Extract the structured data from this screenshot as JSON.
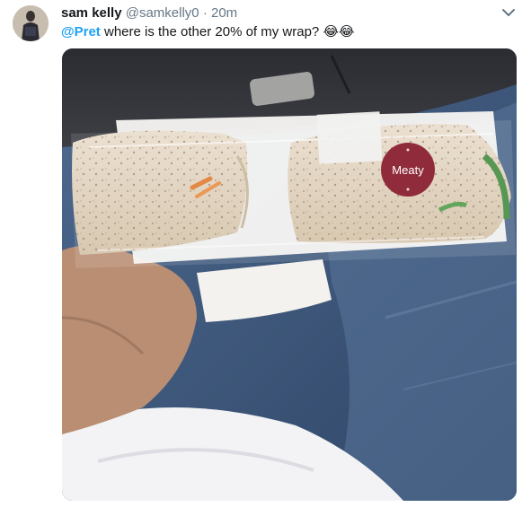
{
  "tweet": {
    "display_name": "sam kelly",
    "handle": "@samkelly0",
    "separator": "·",
    "time": "20m",
    "mention": "@Pret",
    "text": " where is the other 20% of my wrap? ",
    "emojis": "😂😂",
    "sticker_text": "Meaty",
    "menu_icon": "chevron-down-icon"
  },
  "colors": {
    "link": "#1da1f2",
    "sticker": "#8f2b3a"
  }
}
